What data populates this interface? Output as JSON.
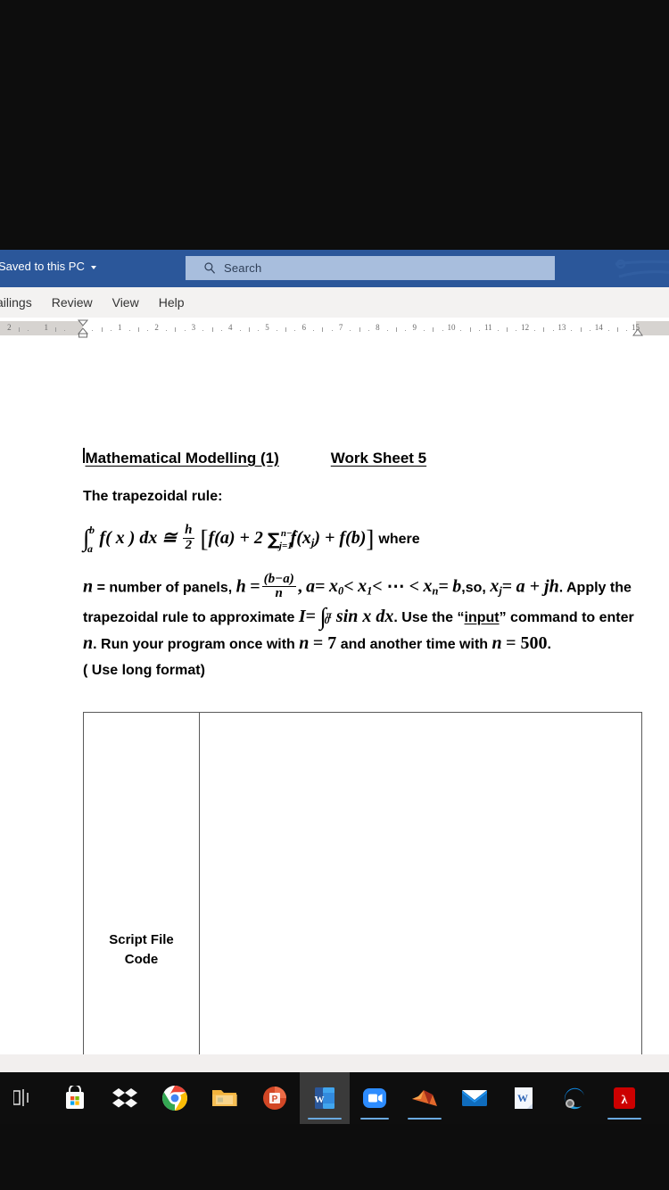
{
  "window": {
    "app": "Microsoft Word",
    "titlebar": {
      "save_state_label": "Saved to this PC",
      "save_state_caret": "chevron-down-icon",
      "accent_color": "#2b579a"
    },
    "search": {
      "placeholder": "Search",
      "value": "",
      "icon": "search-icon"
    }
  },
  "ribbon": {
    "tabs": [
      {
        "label": "ailings",
        "active": false
      },
      {
        "label": "Review",
        "active": false
      },
      {
        "label": "View",
        "active": false
      },
      {
        "label": "Help",
        "active": false
      }
    ]
  },
  "ruler": {
    "left_margin_numbers": [
      "2",
      "1"
    ],
    "numbers": [
      "1",
      "2",
      "3",
      "4",
      "5",
      "6",
      "7",
      "8",
      "9",
      "10",
      "11",
      "12",
      "13",
      "14",
      "15"
    ],
    "left_indent_marker": "hourglass-indent-marker",
    "right_indent_marker": "right-indent-marker"
  },
  "document": {
    "heading": {
      "left": "Mathematical Modelling (1)",
      "right": "Work Sheet 5"
    },
    "subheading": "The trapezoidal rule:",
    "formula": {
      "integral_lower": "a",
      "integral_upper": "b",
      "integrand": "f( x ) dx",
      "approx_sign": "≅",
      "fraction_numerator": "h",
      "fraction_denominator": "2",
      "bracket_open": "[",
      "term_1": "f(a)",
      "plus_1": "+",
      "coefficient": "2",
      "sum_symbol": "∑",
      "sum_upper": "n−1",
      "sum_lower": "j=1",
      "sum_term": "f(x",
      "sum_term_sub": "j",
      "sum_term_close": ")",
      "plus_2": "+",
      "term_2": "f(b)",
      "bracket_close": "]",
      "trailing_word": "where"
    },
    "body": {
      "line1_a": "n",
      "line1_b": "= number of panels,",
      "line1_c": "h",
      "line1_d": "=",
      "line1_frac_num": "(b−a)",
      "line1_frac_den": "n",
      "line1_e": ",",
      "line1_f": "a",
      "line1_g": "=",
      "line1_h": "x",
      "line1_h_sub": "0",
      "line1_i": "<",
      "line1_j": "x",
      "line1_j_sub": "1",
      "line1_k": "< ⋯ <",
      "line1_l": "x",
      "line1_l_sub": "n",
      "line1_m": "=",
      "line1_n": "b",
      "line1_o": ",so,",
      "line2_a": "x",
      "line2_a_sub": "j",
      "line2_b": "=",
      "line2_c": "a + jh",
      "line2_d": ". Apply the trapezoidal rule to approximate",
      "line2_e": "I",
      "line2_f": "=",
      "line3_int_lower": "0",
      "line3_int_upper": "π",
      "line3_a": "sin x dx",
      "line3_b": ". Use the “",
      "line3_underlined": "input",
      "line3_c": "” command to enter",
      "line3_d": "n",
      "line3_e": ". Run your",
      "line4_a": "program once with",
      "line4_b": "n",
      "line4_c": "= 7",
      "line4_d": "and another time with",
      "line4_e": "n",
      "line4_f": "= 500",
      "line4_g": ".",
      "line5": "( Use long format)"
    },
    "table": {
      "left_cell_line1": "Script File",
      "left_cell_line2": "Code",
      "right_cell": ""
    },
    "mouse_cursor": "i-beam-text-cursor"
  },
  "taskbar": {
    "items": [
      {
        "name": "task-view",
        "label": "Task View",
        "active": false,
        "running": false
      },
      {
        "name": "microsoft-store",
        "label": "Microsoft Store",
        "active": false,
        "running": false
      },
      {
        "name": "dropbox",
        "label": "Dropbox",
        "active": false,
        "running": false
      },
      {
        "name": "google-chrome",
        "label": "Google Chrome",
        "active": false,
        "running": false
      },
      {
        "name": "file-explorer",
        "label": "File Explorer",
        "active": false,
        "running": true
      },
      {
        "name": "powerpoint",
        "label": "PowerPoint",
        "active": false,
        "running": false
      },
      {
        "name": "word",
        "label": "Word",
        "active": true,
        "running": true
      },
      {
        "name": "zoom",
        "label": "Zoom",
        "active": false,
        "running": true
      },
      {
        "name": "matlab",
        "label": "MATLAB",
        "active": false,
        "running": true
      },
      {
        "name": "mail",
        "label": "Mail",
        "active": false,
        "running": false
      },
      {
        "name": "wps-writer",
        "label": "WPS Writer",
        "active": false,
        "running": false
      },
      {
        "name": "microsoft-edge",
        "label": "Microsoft Edge",
        "active": false,
        "running": false
      },
      {
        "name": "adobe-acrobat",
        "label": "Adobe Acrobat",
        "active": false,
        "running": true
      }
    ]
  }
}
